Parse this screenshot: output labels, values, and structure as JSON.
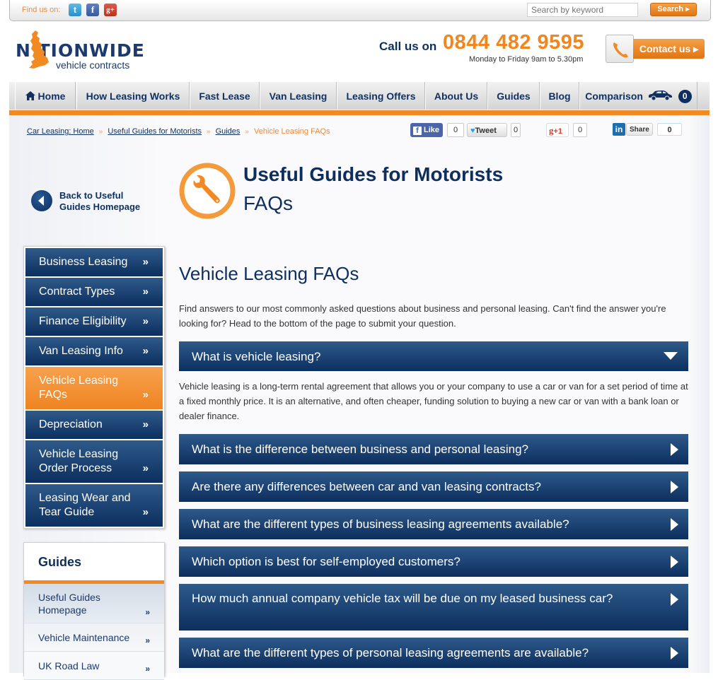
{
  "topbar": {
    "find_us_label": "Find us on:",
    "social": [
      {
        "name": "twitter-icon",
        "glyph": "t"
      },
      {
        "name": "facebook-icon",
        "glyph": "f"
      },
      {
        "name": "google-plus-icon",
        "glyph": "g+"
      }
    ],
    "search_placeholder": "Search by keyword",
    "search_button": "Search ▸"
  },
  "header": {
    "logo_word": "N TIONWIDE",
    "logo_sub": "vehicle contracts",
    "call_label": "Call us on",
    "phone_number": "0844 482 9595",
    "hours": "Monday to Friday 9am to 5.30pm",
    "contact_button": "Contact us ▸"
  },
  "nav": {
    "items": [
      {
        "label": "Home",
        "icon": "home-icon"
      },
      {
        "label": "How Leasing Works"
      },
      {
        "label": "Fast Lease"
      },
      {
        "label": "Van Leasing"
      },
      {
        "label": "Leasing Offers"
      },
      {
        "label": "About Us"
      },
      {
        "label": "Guides"
      },
      {
        "label": "Blog"
      },
      {
        "label": "Comparison",
        "icon": "car-icon",
        "badge": "0"
      }
    ]
  },
  "breadcrumb": {
    "items": [
      "Car Leasing: Home",
      "Useful Guides for Motorists",
      "Guides"
    ],
    "separator": "»",
    "current": "Vehicle Leasing FAQs"
  },
  "share": {
    "facebook": {
      "label": "Like",
      "count": "0"
    },
    "twitter": {
      "label": "Tweet",
      "count": "0"
    },
    "googleplus": {
      "label": "+1",
      "count": "0"
    },
    "linkedin": {
      "label": "Share",
      "count": "0"
    }
  },
  "back_link": {
    "line1": "Back to Useful",
    "line2": "Guides Homepage"
  },
  "hero": {
    "title": "Useful Guides for Motorists",
    "subtitle": "FAQs",
    "icon": "wrench-icon"
  },
  "sidebar": {
    "chevron": "»",
    "items": [
      {
        "label": "Business Leasing",
        "active": false
      },
      {
        "label": "Contract Types",
        "active": false
      },
      {
        "label": "Finance Eligibility",
        "active": false
      },
      {
        "label": "Van Leasing Info",
        "active": false
      },
      {
        "label": "Vehicle Leasing FAQs",
        "active": true
      },
      {
        "label": "Depreciation",
        "active": false
      },
      {
        "label": "Vehicle Leasing Order Process",
        "active": false
      },
      {
        "label": "Leasing Wear and Tear Guide",
        "active": false
      }
    ],
    "guides": {
      "title": "Guides",
      "items": [
        "Useful Guides Homepage",
        "Vehicle Maintenance",
        "UK Road Law"
      ]
    }
  },
  "main": {
    "title": "Vehicle Leasing FAQs",
    "intro": "Find answers to our most commonly asked questions about business and personal leasing. Can't find the answer you're looking for? Head to the bottom of the page to submit your question.",
    "faqs": [
      {
        "question": "What is vehicle leasing?",
        "expanded": true,
        "answer": "Vehicle leasing is a long-term rental agreement that allows you or your company to use a car or van for a set period of time at a fixed monthly price. It is an alternative, and often cheaper, funding solution to buying a new car or van with a bank loan or dealer finance."
      },
      {
        "question": "What is the difference between business and personal leasing?",
        "expanded": false
      },
      {
        "question": "Are there any differences between car and van leasing contracts?",
        "expanded": false
      },
      {
        "question": "What are the different types of business leasing agreements available?",
        "expanded": false
      },
      {
        "question": "Which option is best for self-employed customers?",
        "expanded": false
      },
      {
        "question": "How much annual company vehicle tax will be due on my leased business car?",
        "expanded": false
      },
      {
        "question": "What are the different types of personal leasing agreements are available?",
        "expanded": false
      }
    ]
  },
  "colors": {
    "navy": "#0e2f5e",
    "orange": "#f28a24",
    "text": "#333333"
  }
}
